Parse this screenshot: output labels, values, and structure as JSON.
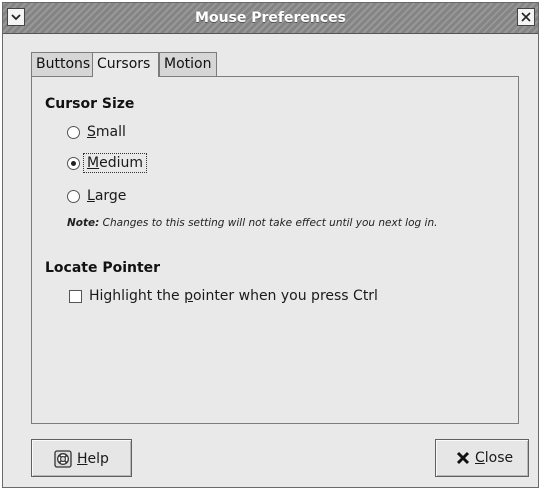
{
  "window": {
    "title": "Mouse Preferences"
  },
  "tabs": [
    {
      "label": "Buttons"
    },
    {
      "label": "Cursors"
    },
    {
      "label": "Motion"
    }
  ],
  "cursor_size": {
    "heading": "Cursor Size",
    "options": [
      {
        "mnemonic": "S",
        "rest": "mall"
      },
      {
        "mnemonic": "M",
        "rest": "edium"
      },
      {
        "mnemonic": "L",
        "rest": "arge"
      }
    ],
    "selected": "Medium",
    "note_prefix": "Note:",
    "note_text": " Changes to this setting will not take effect until you next log in."
  },
  "locate_pointer": {
    "heading": "Locate Pointer",
    "checkbox_pre": "Highlight the ",
    "checkbox_mnemonic": "p",
    "checkbox_post": "ointer when you press Ctrl",
    "checked": false
  },
  "buttons": {
    "help_mnemonic": "H",
    "help_rest": "elp",
    "close_mnemonic": "C",
    "close_rest": "lose"
  },
  "icons": {
    "window_menu": "window-menu-icon",
    "window_close": "window-close-icon",
    "help": "help-lifebuoy-icon",
    "close": "close-x-icon"
  }
}
